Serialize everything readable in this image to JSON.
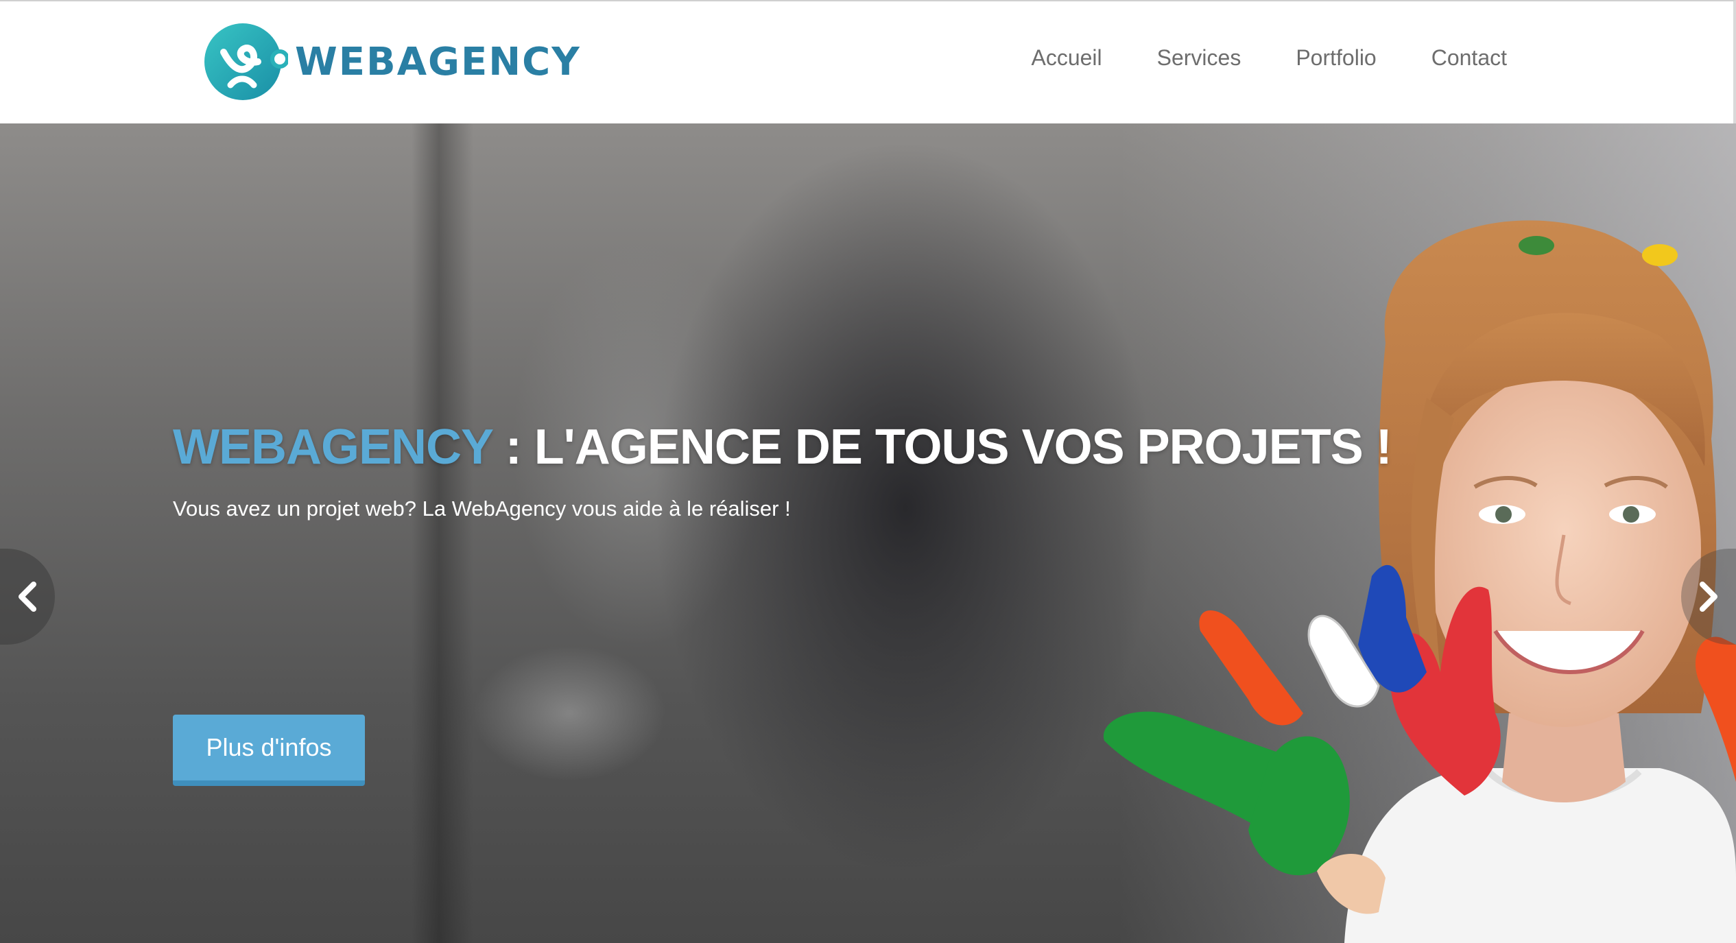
{
  "header": {
    "logo_text": "WEBAGENCY",
    "logo_icon": "webagency-logo-icon",
    "nav": [
      {
        "label": "Accueil"
      },
      {
        "label": "Services"
      },
      {
        "label": "Portfolio"
      },
      {
        "label": "Contact"
      }
    ]
  },
  "hero": {
    "title_brand": "WEBAGENCY",
    "title_rest": " : L'AGENCE DE TOUS VOS PROJETS !",
    "subtitle": "Vous avez un projet web? La WebAgency vous aide à le réaliser !",
    "button_label": "Plus d'infos",
    "prev_icon": "chevron-left-icon",
    "next_icon": "chevron-right-icon"
  },
  "colors": {
    "brand_blue": "#5aaad6",
    "logo_blue": "#2a7fa4",
    "logo_teal": "#2ab1b9",
    "nav_text": "#6d6d6d"
  }
}
